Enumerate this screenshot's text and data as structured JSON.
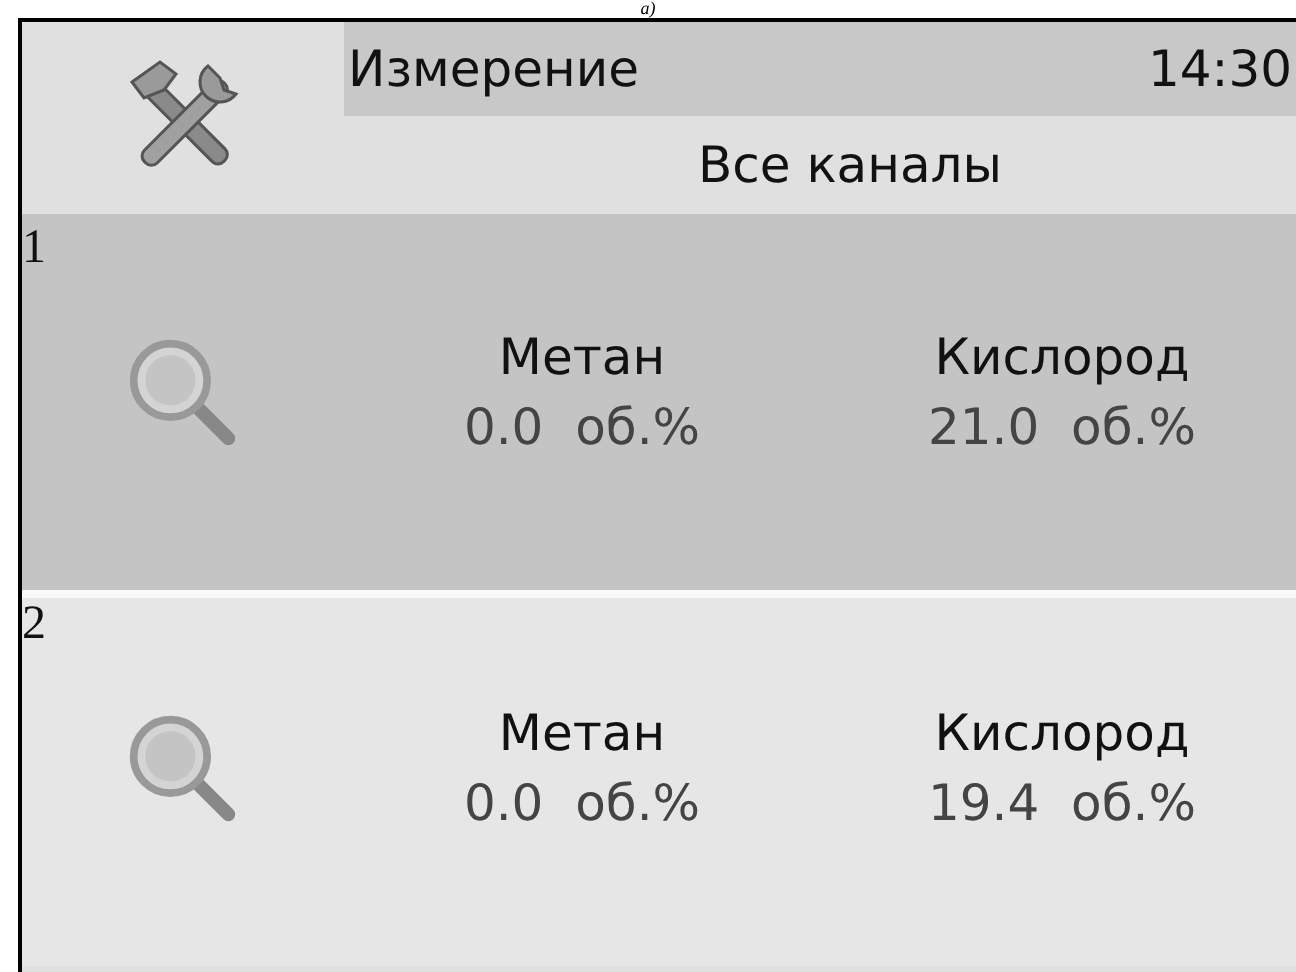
{
  "caption": "а)",
  "header": {
    "title": "Измерение",
    "time": "14:30",
    "subtitle": "Все каналы"
  },
  "channels": [
    {
      "number": "1",
      "selected": true,
      "readings": [
        {
          "name": "Метан",
          "value": "0.0  об.%"
        },
        {
          "name": "Кислород",
          "value": "21.0  об.%"
        }
      ]
    },
    {
      "number": "2",
      "selected": false,
      "readings": [
        {
          "name": "Метан",
          "value": "0.0  об.%"
        },
        {
          "name": "Кислород",
          "value": "19.4  об.%"
        }
      ]
    }
  ]
}
